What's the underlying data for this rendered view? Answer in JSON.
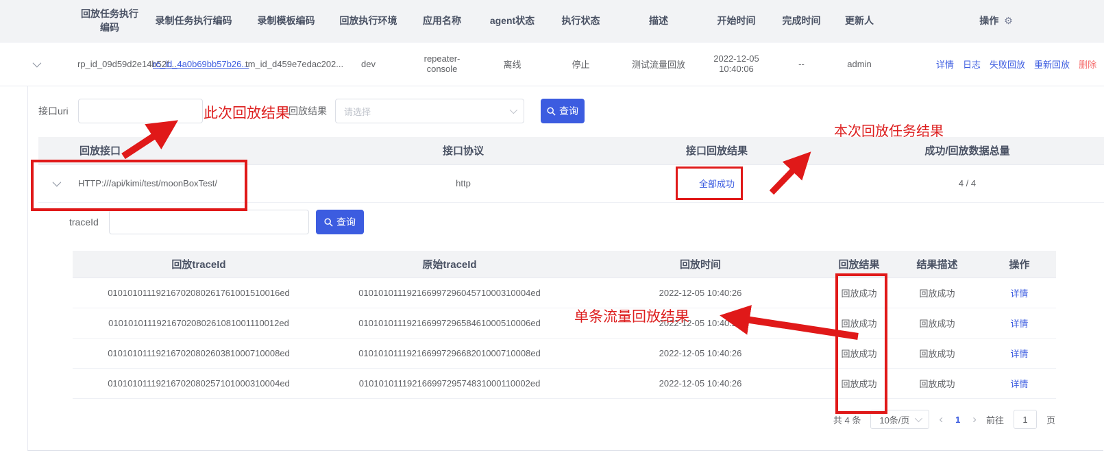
{
  "colors": {
    "accent_blue": "#3c5ce0",
    "success_green": "#67c23a",
    "danger_red": "#f56c6c",
    "annotation_red": "#e01919",
    "header_bg": "#f2f3f5"
  },
  "icons": {
    "gear": "⚙"
  },
  "task_table": {
    "headers": [
      "回放任务执行编码",
      "录制任务执行编码",
      "录制模板编码",
      "回放执行环境",
      "应用名称",
      "agent状态",
      "执行状态",
      "描述",
      "开始时间",
      "完成时间",
      "更新人",
      "操作"
    ],
    "row": {
      "rp_id": "rp_id_09d59d2e14b52f...",
      "rc_id": "rc_id_4a0b69bb57b26...",
      "tm_id": "tm_id_d459e7edac202...",
      "env": "dev",
      "app_name": "repeater-console",
      "agent_status": "离线",
      "exec_status": "停止",
      "description": "测试流量回放",
      "start_time": "2022-12-05 10:40:06",
      "finish_time": "--",
      "updater": "admin",
      "actions": [
        "详情",
        "日志",
        "失败回放",
        "重新回放",
        "删除"
      ]
    }
  },
  "filters": {
    "uri_label": "接口uri",
    "uri_value": "",
    "result_label": "回放结果",
    "result_placeholder": "请选择",
    "search_label": "查询",
    "traceid_label": "traceId",
    "traceid_value": ""
  },
  "interface_table": {
    "headers": [
      "回放接口",
      "接口协议",
      "接口回放结果",
      "成功/回放数据总量"
    ],
    "row": {
      "replay_interface": "HTTP:///api/kimi/test/moonBoxTest/",
      "protocol": "http",
      "result": "全部成功",
      "success_total": "4 / 4"
    }
  },
  "trace_table": {
    "headers": [
      "回放traceId",
      "原始traceId",
      "回放时间",
      "回放结果",
      "结果描述",
      "操作"
    ],
    "rows": [
      {
        "replay_trace_id": "01010101119216702080261761001510016ed",
        "origin_trace_id": "01010101119216699729604571000310004ed",
        "replay_time": "2022-12-05 10:40:26",
        "result": "回放成功",
        "result_desc": "回放成功",
        "action": "详情"
      },
      {
        "replay_trace_id": "01010101119216702080261081001110012ed",
        "origin_trace_id": "01010101119216699729658461000510006ed",
        "replay_time": "2022-12-05 10:40:26",
        "result": "回放成功",
        "result_desc": "回放成功",
        "action": "详情"
      },
      {
        "replay_trace_id": "01010101119216702080260381000710008ed",
        "origin_trace_id": "01010101119216699729668201000710008ed",
        "replay_time": "2022-12-05 10:40:26",
        "result": "回放成功",
        "result_desc": "回放成功",
        "action": "详情"
      },
      {
        "replay_trace_id": "01010101119216702080257101000310004ed",
        "origin_trace_id": "01010101119216699729574831000110002ed",
        "replay_time": "2022-12-05 10:40:26",
        "result": "回放成功",
        "result_desc": "回放成功",
        "action": "详情"
      }
    ]
  },
  "pagination": {
    "total": "共 4 条",
    "page_size": "10条/页",
    "prev": "‹",
    "current": "1",
    "next": "›",
    "goto_label": "前往",
    "goto_value": "1",
    "page_suffix": "页"
  },
  "annotations": {
    "filter_note": "此次回放结果",
    "task_result_note": "本次回放任务结果",
    "single_note": "单条流量回放结果"
  }
}
